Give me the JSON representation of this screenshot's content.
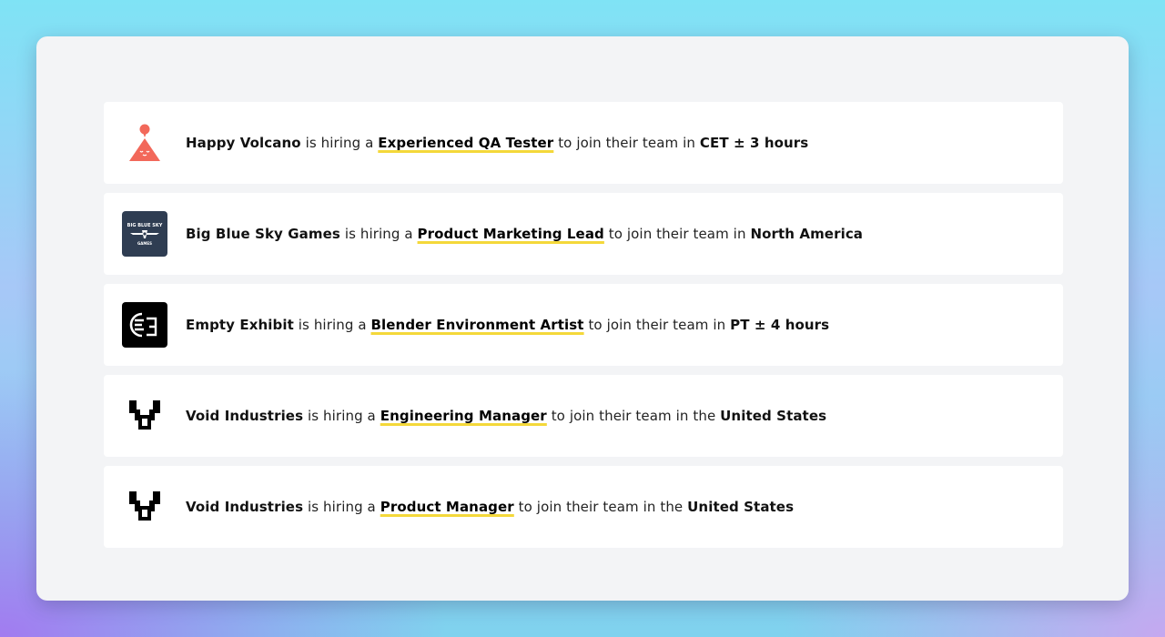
{
  "connectors": {
    "is_hiring": "is hiring a",
    "to_join": "to join their team in",
    "the": "the"
  },
  "colors": {
    "role_underline": "#f4d83a",
    "happy_volcano_logo": "#f2685a",
    "big_blue_sky_logo_bg": "#2f3d52"
  },
  "jobs": [
    {
      "company": "Happy Volcano",
      "role": "Experienced QA Tester",
      "location_prefix": "",
      "location": "CET ± 3 hours",
      "logo_icon": "volcano-icon"
    },
    {
      "company": "Big Blue Sky Games",
      "role": "Product Marketing Lead",
      "location_prefix": "",
      "location": "North America",
      "logo_icon": "big-blue-sky-logo",
      "logo_text_top": "BIG BLUE SKY",
      "logo_text_bottom": "GAMES"
    },
    {
      "company": "Empty Exhibit",
      "role": "Blender Environment Artist",
      "location_prefix": "",
      "location": "PT ± 4 hours",
      "logo_icon": "empty-exhibit-logo"
    },
    {
      "company": "Void Industries",
      "role": "Engineering Manager",
      "location_prefix": "the",
      "location": "United States",
      "logo_icon": "void-industries-logo"
    },
    {
      "company": "Void Industries",
      "role": "Product Manager",
      "location_prefix": "the",
      "location": "United States",
      "logo_icon": "void-industries-logo"
    }
  ]
}
